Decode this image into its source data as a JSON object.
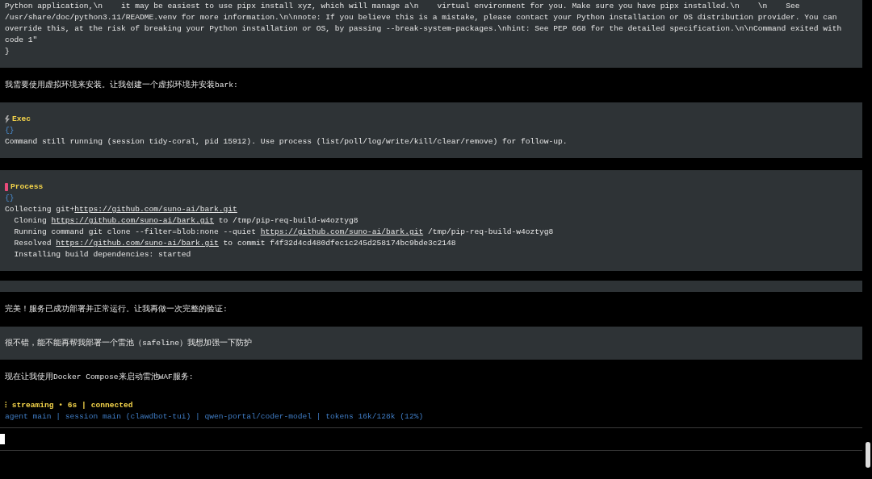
{
  "blocks": [
    {
      "kind": "output",
      "lines": [
        [
          {
            "text": "Python application,\\n    it may be easiest to use pipx install xyz, which will manage a\\n    virtual environment for you. Make sure you have pipx installed.\\n    \\n    See"
          }
        ],
        [
          {
            "text": "/usr/share/doc/python3.11/README.venv for more information.\\n\\nnote: If you believe this is a mistake, please contact your Python installation or OS distribution provider. You can"
          }
        ],
        [
          {
            "text": "override this, at the risk of breaking your Python installation or OS, by passing --break-system-packages.\\nhint: See PEP 668 for the detailed specification.\\n\\nCommand exited with"
          }
        ],
        [
          {
            "text": "code 1\""
          }
        ],
        [
          {
            "text": "}"
          }
        ]
      ]
    },
    {
      "kind": "assistant",
      "text": "我需要使用虚拟环境来安装。让我创建一个虚拟环境并安装bark:"
    },
    {
      "kind": "exec",
      "title": "Exec",
      "args": "{}",
      "lines": [
        [
          {
            "text": "Command still running (session tidy-coral, pid 15912). Use process (list/poll/log/write/kill/clear/remove) for follow-up."
          }
        ]
      ]
    },
    {
      "kind": "process",
      "title": "Process",
      "args": "{}",
      "lines": [
        [
          {
            "text": "Collecting git+"
          },
          {
            "text": "https://github.com/suno-ai/bark.git",
            "link": true
          }
        ],
        [
          {
            "text": "  Cloning "
          },
          {
            "text": "https://github.com/suno-ai/bark.git",
            "link": true
          },
          {
            "text": " to /tmp/pip-req-build-w4oztyg8"
          }
        ],
        [
          {
            "text": "  Running command git clone --filter=blob:none --quiet "
          },
          {
            "text": "https://github.com/suno-ai/bark.git",
            "link": true
          },
          {
            "text": " /tmp/pip-req-build-w4oztyg8"
          }
        ],
        [
          {
            "text": "  Resolved "
          },
          {
            "text": "https://github.com/suno-ai/bark.git",
            "link": true
          },
          {
            "text": " to commit f4f32d4cd480dfec1c245d258174bc9bde3c2148"
          }
        ],
        [
          {
            "text": "  Installing build dependencies: started"
          }
        ]
      ]
    },
    {
      "kind": "strip"
    },
    {
      "kind": "assistant",
      "text": "完美！服务已成功部署并正常运行。让我再做一次完整的验证:"
    },
    {
      "kind": "user",
      "text": "很不错，能不能再帮我部署一个雷池（safeline）我想加强一下防护"
    },
    {
      "kind": "assistant",
      "text": "现在让我使用Docker Compose来启动雷池WAF服务:"
    }
  ],
  "status": "⁝ streaming • 6s | connected",
  "footer": "agent main | session main (clawdbot-tui) | qwen-portal/coder-model | tokens 16k/128k (12%)"
}
